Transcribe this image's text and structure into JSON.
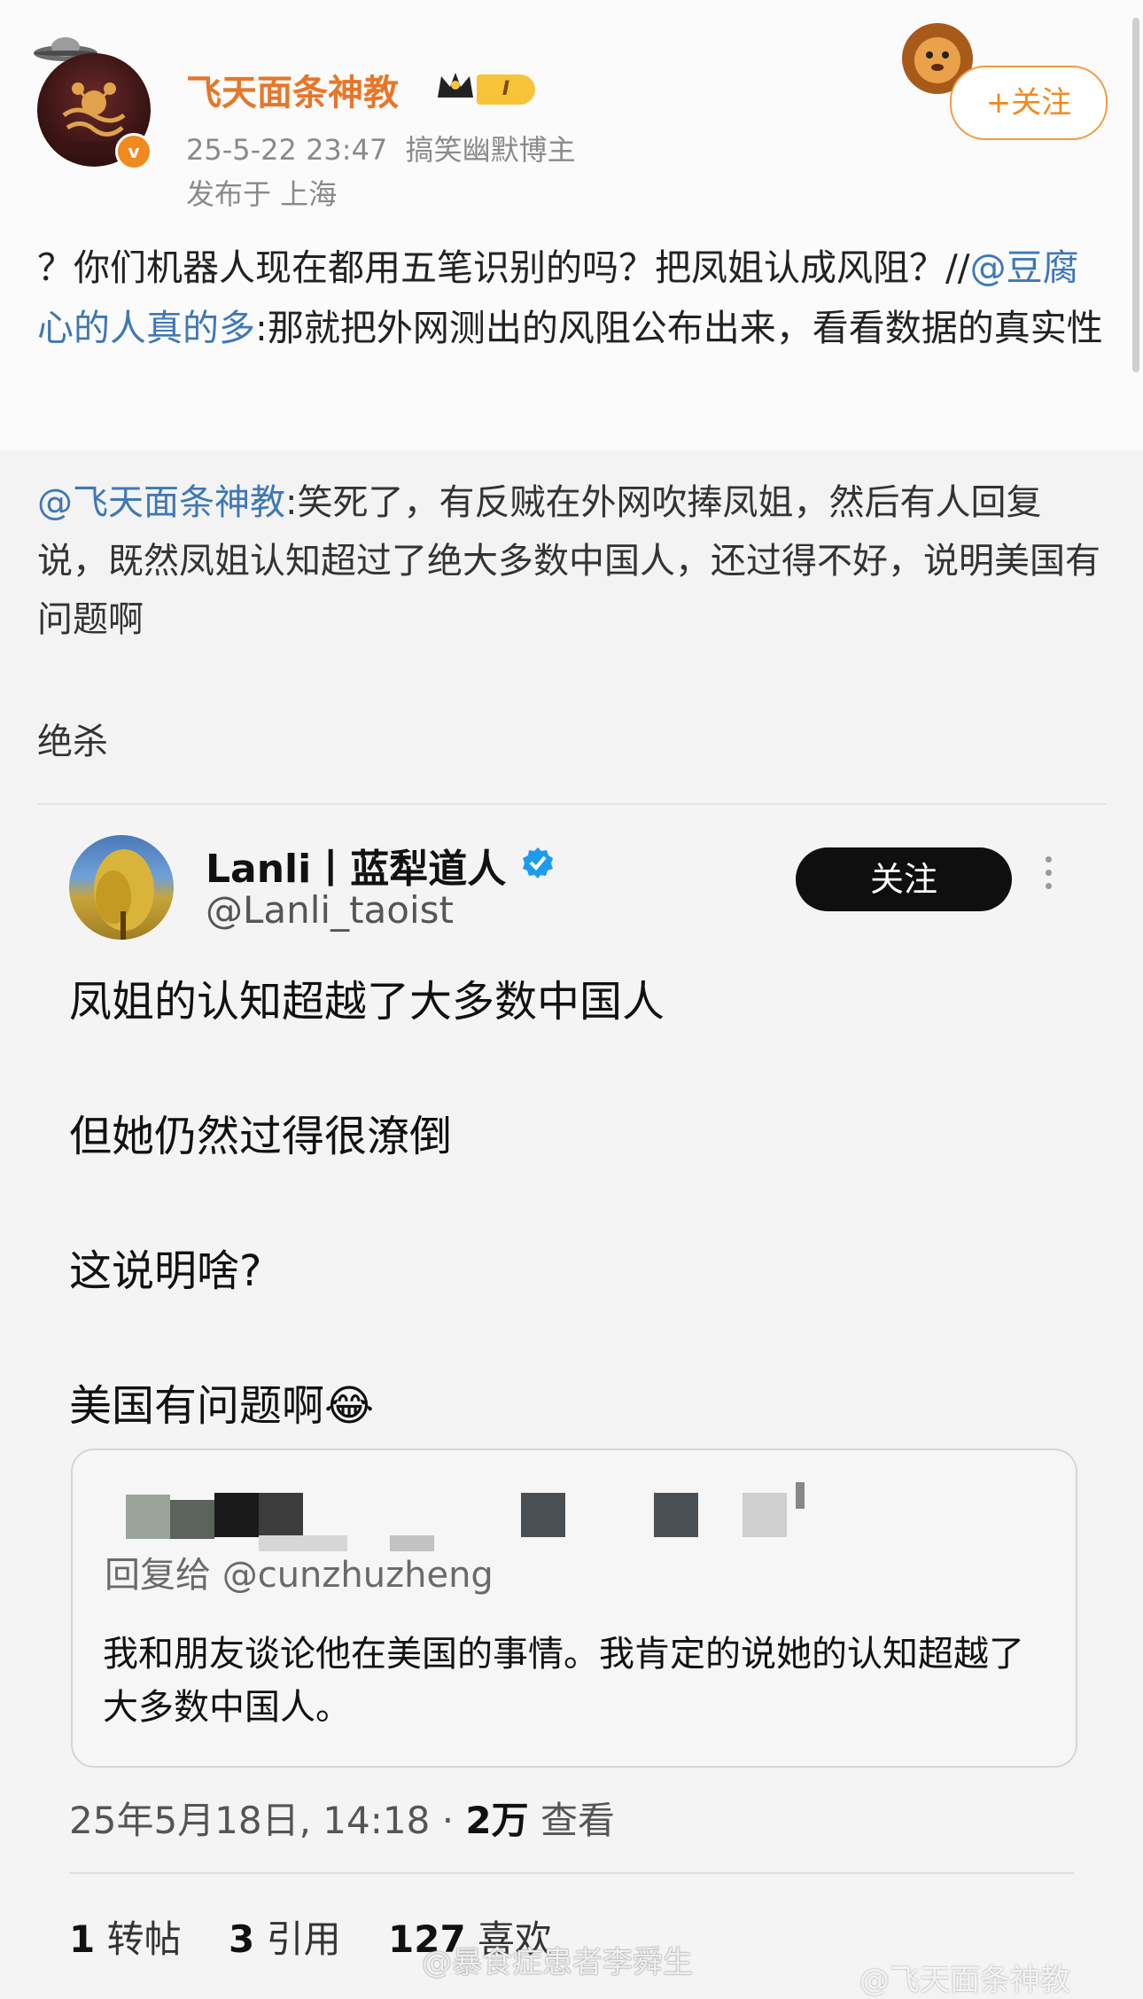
{
  "weibo": {
    "username": "飞天面条神教",
    "level": "I",
    "timestamp": "25-5-22 23:47",
    "category": "搞笑幽默博主",
    "location": "发布于 上海",
    "follow_label": "+关注",
    "post_part1": "？你们机器人现在都用五笔识别的吗？把凤姐认成风阻？//",
    "post_mention": "@豆腐心的人真的多",
    "post_part2": ":那就把外网测出的风阻公布出来，看看数据的真实性",
    "repost_mention": "@飞天面条神教",
    "repost_text": ":笑死了，有反贼在外网吹捧凤姐，然后有人回复说，既然凤姐认知超过了绝大多数中国人，还过得不好，说明美国有问题啊",
    "remark": "绝杀"
  },
  "tweet": {
    "name": "Lanli丨蓝犁道人",
    "handle": "@Lanli_taoist",
    "follow_label": "关注",
    "lines": [
      "凤姐的认知超越了大多数中国人",
      "但她仍然过得很潦倒",
      "这说明啥?",
      "美国有问题啊😂"
    ],
    "quote_reply": "回复给 @cunzhuzheng",
    "quote_text": "我和朋友谈论他在美国的事情。我肯定的说她的认知超越了大多数中国人。",
    "time": "25年5月18日, 14:18 · ",
    "views_count": "2万",
    "views_label": " 查看",
    "reposts_count": "1",
    "reposts_label": " 转帖",
    "quotes_count": "3",
    "quotes_label": " 引用",
    "likes_count": "127",
    "likes_label": " 喜欢"
  },
  "watermarks": [
    "@暴食症患者李舜生",
    "@飞天面条神教"
  ],
  "colors": {
    "username_orange": "#e7762a",
    "mention_blue": "#3f78b5",
    "verified_blue": "#1d9bf0",
    "follow_orange": "#f08a1f"
  }
}
